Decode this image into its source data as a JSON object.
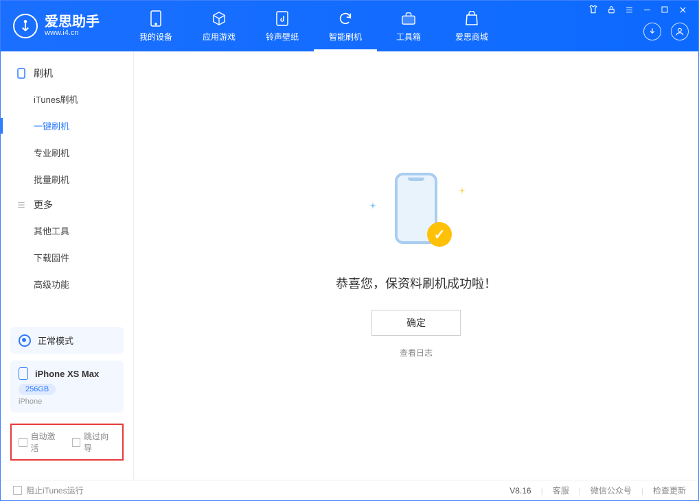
{
  "brand": {
    "name": "爱思助手",
    "url": "www.i4.cn"
  },
  "nav": {
    "tabs": [
      {
        "label": "我的设备"
      },
      {
        "label": "应用游戏"
      },
      {
        "label": "铃声壁纸"
      },
      {
        "label": "智能刷机"
      },
      {
        "label": "工具箱"
      },
      {
        "label": "爱思商城"
      }
    ]
  },
  "sidebar": {
    "section_flash_title": "刷机",
    "flash_items": [
      {
        "label": "iTunes刷机"
      },
      {
        "label": "一键刷机"
      },
      {
        "label": "专业刷机"
      },
      {
        "label": "批量刷机"
      }
    ],
    "section_more_title": "更多",
    "more_items": [
      {
        "label": "其他工具"
      },
      {
        "label": "下载固件"
      },
      {
        "label": "高级功能"
      }
    ],
    "mode_label": "正常模式",
    "device": {
      "name": "iPhone XS Max",
      "storage": "256GB",
      "type": "iPhone"
    },
    "options": {
      "auto_activate": "自动激活",
      "skip_guide": "跳过向导"
    }
  },
  "main": {
    "success_message": "恭喜您，保资料刷机成功啦！",
    "ok_button": "确定",
    "view_log": "查看日志"
  },
  "status": {
    "stop_itunes": "阻止iTunes运行",
    "version": "V8.16",
    "links": {
      "support": "客服",
      "wechat": "微信公众号",
      "update": "检查更新"
    }
  }
}
